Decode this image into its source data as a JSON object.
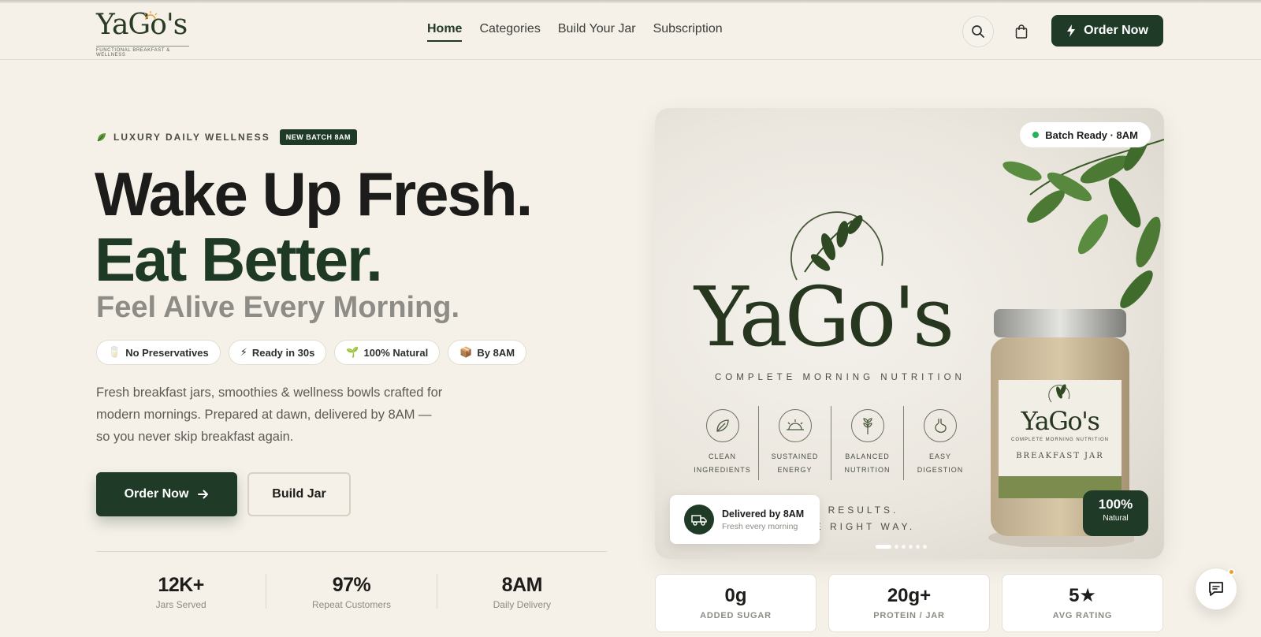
{
  "header": {
    "logo_word": "YaGo's",
    "logo_tagline": "FUNCTIONAL BREAKFAST & WELLNESS",
    "nav": [
      {
        "label": "Home",
        "active": true
      },
      {
        "label": "Categories",
        "active": false
      },
      {
        "label": "Build Your Jar",
        "active": false
      },
      {
        "label": "Subscription",
        "active": false
      }
    ],
    "search_icon": "search-icon",
    "cart_icon": "bag-icon",
    "order_button": "Order Now"
  },
  "hero": {
    "eyebrow": "LUXURY DAILY WELLNESS",
    "badge": "NEW BATCH 8AM",
    "headline_1": "Wake Up Fresh.",
    "headline_2": "Eat Better.",
    "headline_3": "Feel Alive Every Morning.",
    "pills": [
      {
        "icon": "🥛",
        "label": "No Preservatives"
      },
      {
        "icon": "⚡",
        "label": "Ready in 30s"
      },
      {
        "icon": "🌱",
        "label": "100% Natural"
      },
      {
        "icon": "📦",
        "label": "By 8AM"
      }
    ],
    "description": "Fresh breakfast jars, smoothies & wellness bowls crafted for modern mornings. Prepared at dawn, delivered by 8AM — so you never skip breakfast again.",
    "primary_cta": "Order Now",
    "secondary_cta": "Build Jar",
    "stats": [
      {
        "value": "12K+",
        "label": "Jars Served"
      },
      {
        "value": "97%",
        "label": "Repeat Customers"
      },
      {
        "value": "8AM",
        "label": "Daily Delivery"
      }
    ]
  },
  "card": {
    "batch_status": "Batch Ready · 8AM",
    "brand": "YaGo's",
    "subtitle": "COMPLETE MORNING NUTRITION",
    "features": [
      {
        "label": "CLEAN\nINGREDIENTS",
        "icon": "leaf-icon"
      },
      {
        "label": "SUSTAINED\nENERGY",
        "icon": "sunrise-icon"
      },
      {
        "label": "BALANCED\nNUTRITION",
        "icon": "wheat-icon"
      },
      {
        "label": "EASY\nDIGESTION",
        "icon": "stomach-icon"
      }
    ],
    "results_line_1": "AL RESULTS.",
    "results_line_2": "HE RIGHT WAY.",
    "jar_brand": "YaGo's",
    "jar_subtitle": "COMPLETE MORNING NUTRITION",
    "jar_label": "BREAKFAST JAR",
    "natural_value": "100%",
    "natural_label": "Natural",
    "delivery_title": "Delivered by 8AM",
    "delivery_sub": "Fresh every morning",
    "slides": 6,
    "active_slide": 1
  },
  "metrics": [
    {
      "value": "0g",
      "label": "ADDED SUGAR"
    },
    {
      "value": "20g+",
      "label": "PROTEIN / JAR"
    },
    {
      "value": "5★",
      "label": "AVG RATING"
    }
  ],
  "chat_icon": "chat-icon",
  "colors": {
    "brand_green": "#1f3a27",
    "background": "#f5f1e9",
    "status_green": "#23b35b",
    "notice_orange": "#f29b2b"
  }
}
